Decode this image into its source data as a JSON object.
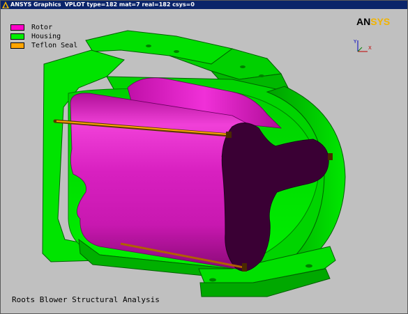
{
  "window": {
    "title_app": "ANSYS Graphics",
    "title_info": "VPLOT  type=182 mat=7 real=182 csys=0"
  },
  "legend": {
    "items": [
      {
        "label": "Rotor",
        "color": "#ff00ff"
      },
      {
        "label": "Housing",
        "color": "#00ff00"
      },
      {
        "label": "Teflon Seal",
        "color": "#ffa500"
      }
    ]
  },
  "logo": {
    "part1": "AN",
    "part2": "SYS"
  },
  "triad": {
    "axis_x": "X",
    "axis_y": "Y"
  },
  "caption": "Roots Blower Structural Analysis",
  "colors": {
    "background": "#c0c0c0",
    "housing": "#00e000",
    "housing_dark": "#007800",
    "rotor": "#e020c0",
    "rotor_section": "#3c0036",
    "seal": "#ffa500"
  }
}
